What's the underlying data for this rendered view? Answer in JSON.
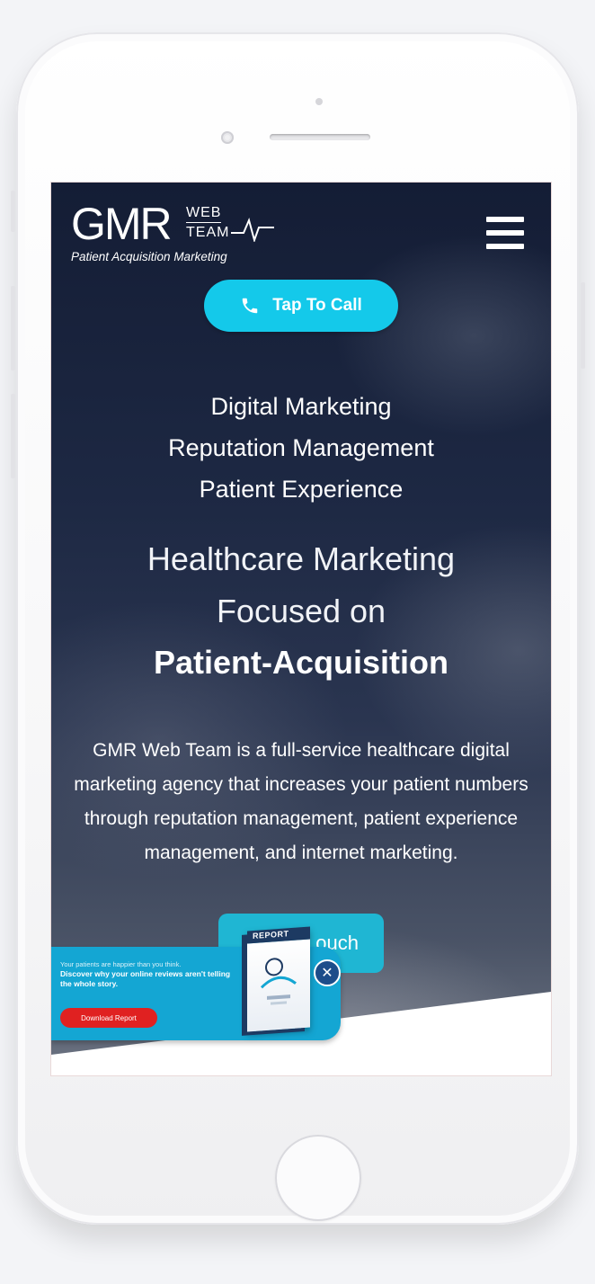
{
  "brand": {
    "logo_main": "GMR",
    "logo_web": "WEB",
    "logo_team": "TEAM",
    "tagline": "Patient Acquisition Marketing"
  },
  "header": {
    "menu_icon": "hamburger-menu-icon",
    "call_button_label": "Tap To Call",
    "call_icon": "phone-icon"
  },
  "hero": {
    "services": [
      "Digital Marketing",
      "Reputation Management",
      "Patient Experience"
    ],
    "headline_lines": [
      "Healthcare Marketing",
      "Focused on"
    ],
    "headline_strong": "Patient-Acquisition",
    "intro": "GMR Web Team is a full-service healthcare digital marketing agency that increases your patient numbers through reputation management, patient experience management, and internet marketing.",
    "cta_visible_label": "ouch"
  },
  "popup": {
    "line1": "Your patients are happier than you think.",
    "line2": "Discover why your online reviews aren't telling the whole story.",
    "download_label": "Download Report",
    "report_cover_label": "REPORT",
    "close_icon": "close-icon"
  },
  "colors": {
    "accent_cyan": "#14c9ea",
    "popup_blue": "#14a6d3",
    "download_red": "#e02121",
    "hero_navy": "#1b2641"
  }
}
